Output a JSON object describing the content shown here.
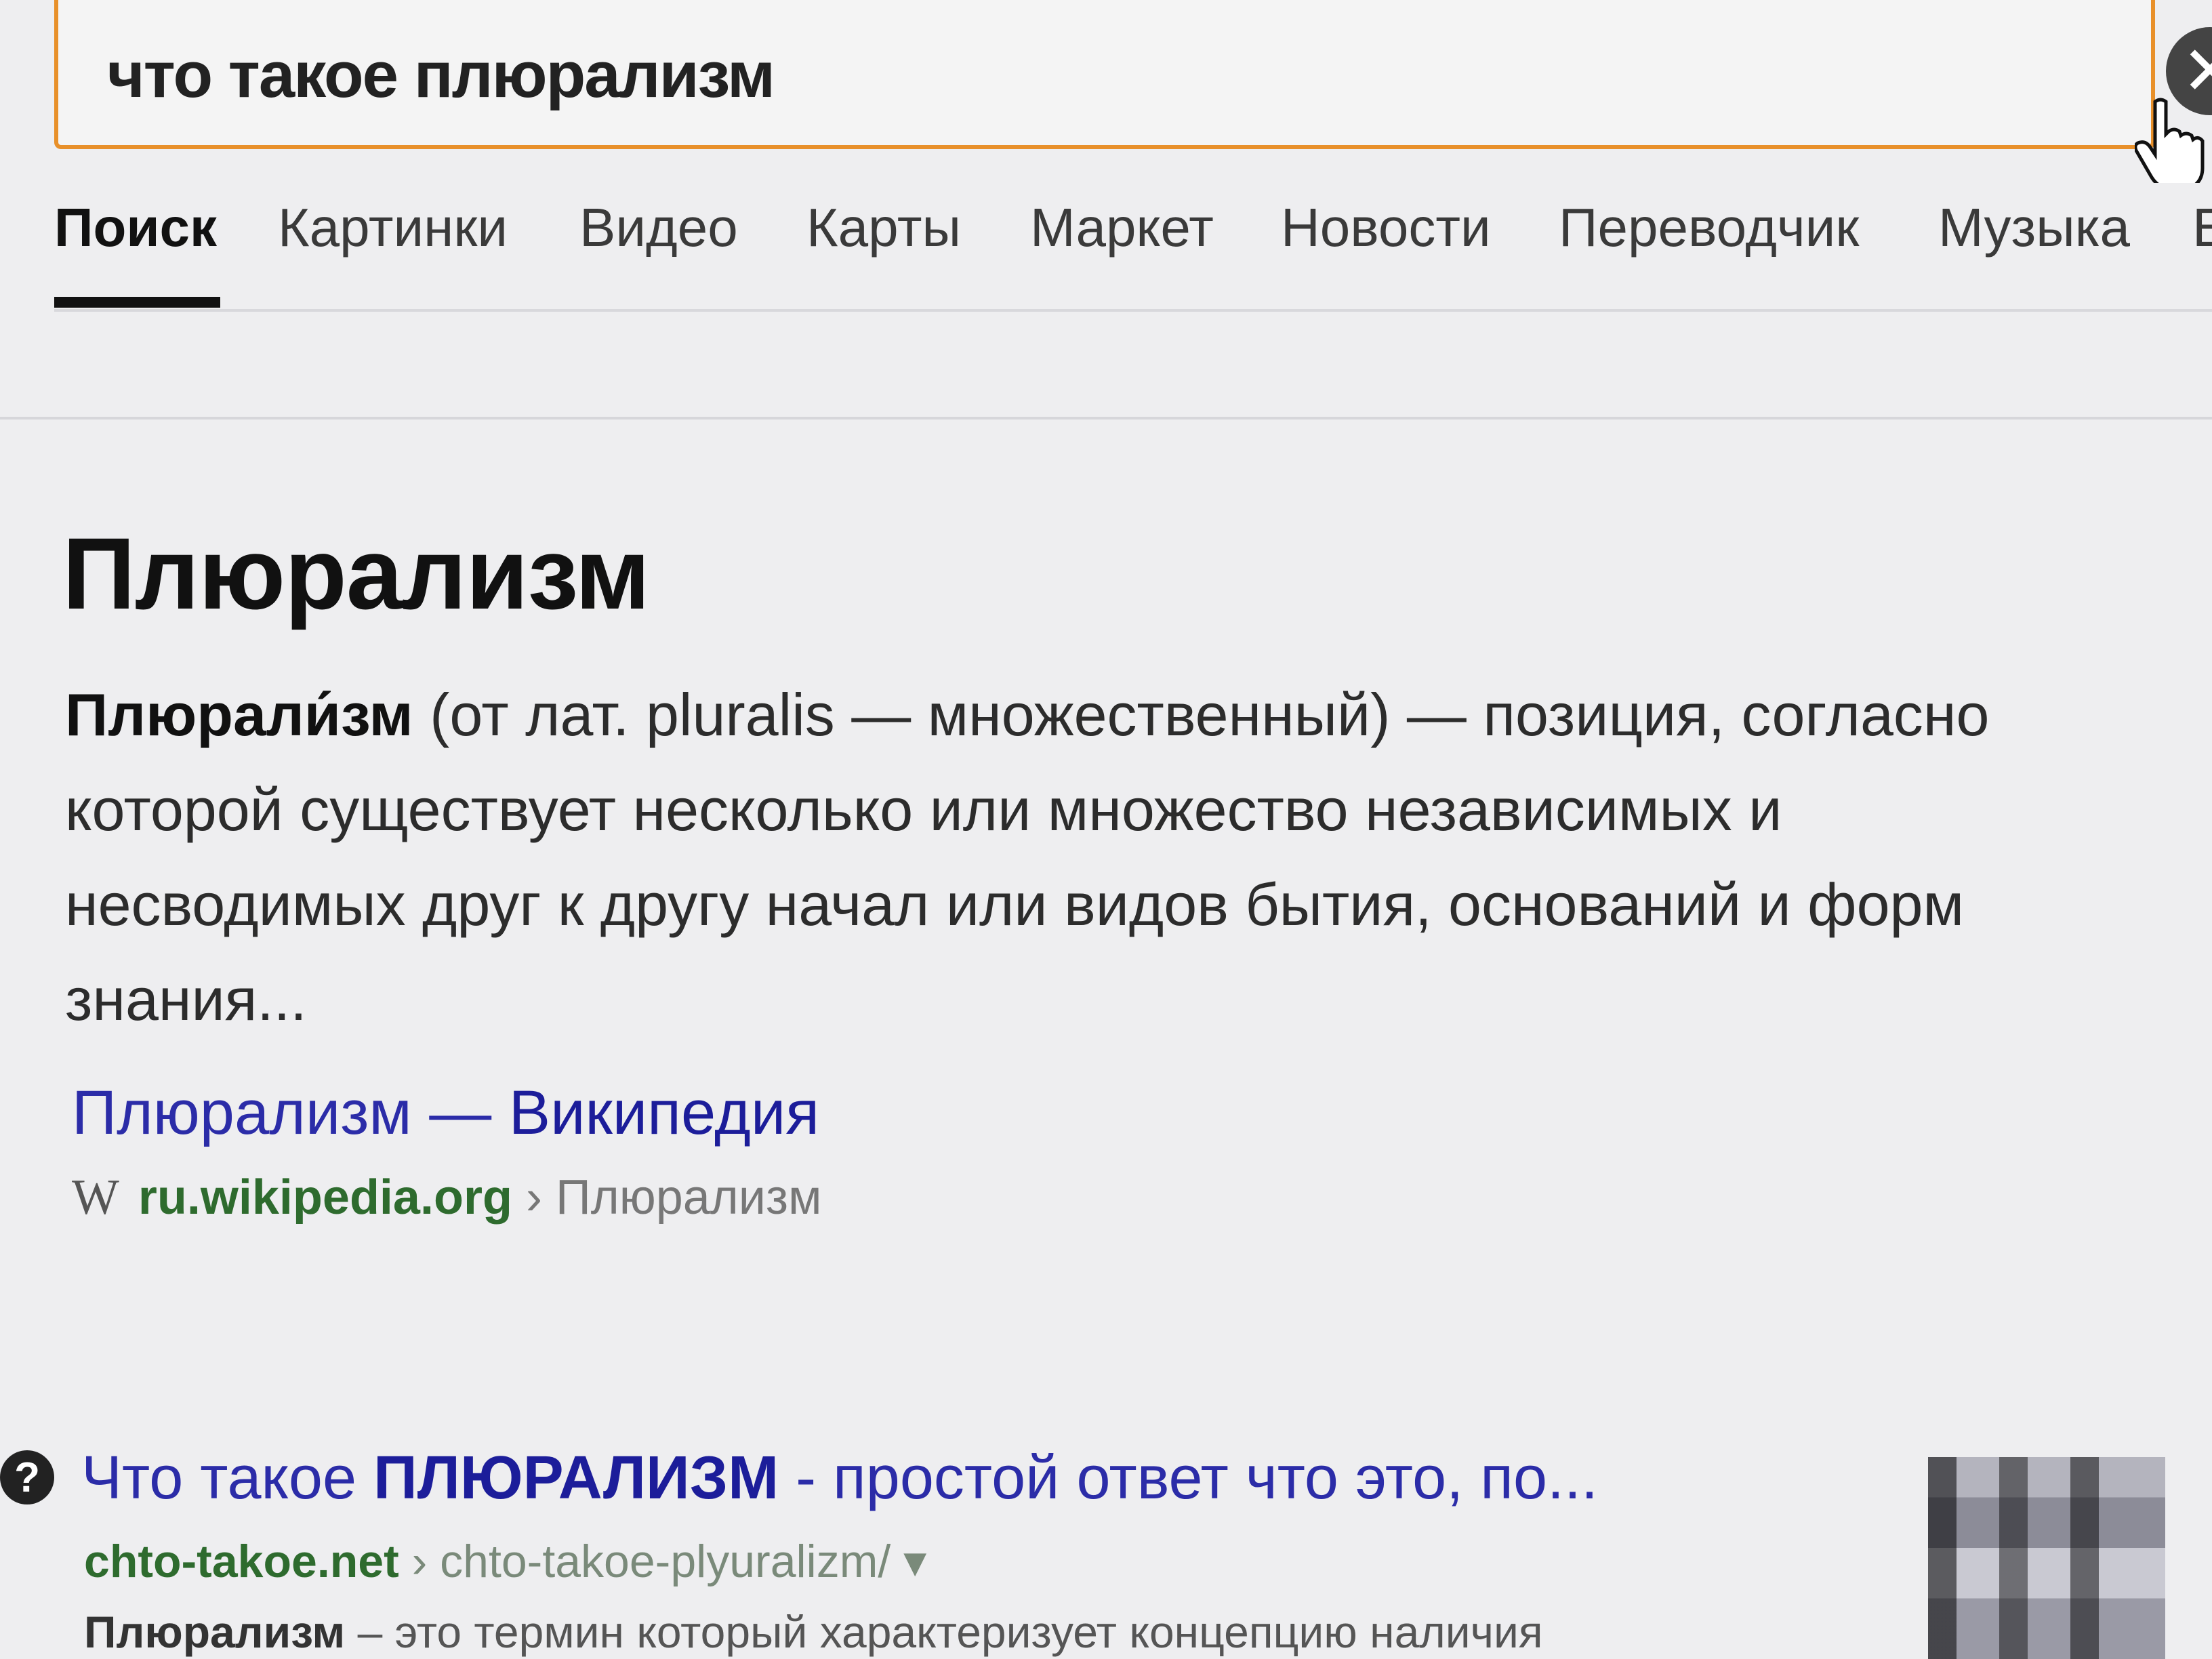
{
  "search": {
    "query": "что такое плюрализм",
    "clear_symbol": "✕"
  },
  "tabs": [
    {
      "label": "Поиск",
      "active": true
    },
    {
      "label": "Картинки"
    },
    {
      "label": "Видео"
    },
    {
      "label": "Карты"
    },
    {
      "label": "Маркет"
    },
    {
      "label": "Новости"
    },
    {
      "label": "Переводчик"
    },
    {
      "label": "Музыка"
    },
    {
      "label": "Е"
    }
  ],
  "card": {
    "title": "Плюрализм",
    "term": "Плюрали́зм",
    "text": " (от лат. pluralis — множественный) — позиция, согласно которой существует несколько или множество независимых и несводимых друг к другу начал или видов бытия, оснований и форм знания...",
    "link_title": "Плюрализм",
    "link_sep": " — ",
    "link_brand": "Википедия",
    "source_icon": "W",
    "source_domain": "ru.wikipedia.org",
    "source_crumb": " › Плюрализм"
  },
  "result2": {
    "icon": "?",
    "title_prefix": "Что такое ",
    "title_highlight": "ПЛЮРАЛИЗМ",
    "title_suffix": " - простой ответ что это, по...",
    "url_domain": "chto-takoe.net",
    "url_path": " › chto-takoe-plyuralizm/ ▾",
    "snippet_term": "Плюрализм",
    "snippet_text": " – это термин который характеризует концепцию наличия"
  },
  "colors": {
    "accent": "#e8902a",
    "link": "#2b2ca8",
    "url_green": "#2e6b2e"
  }
}
